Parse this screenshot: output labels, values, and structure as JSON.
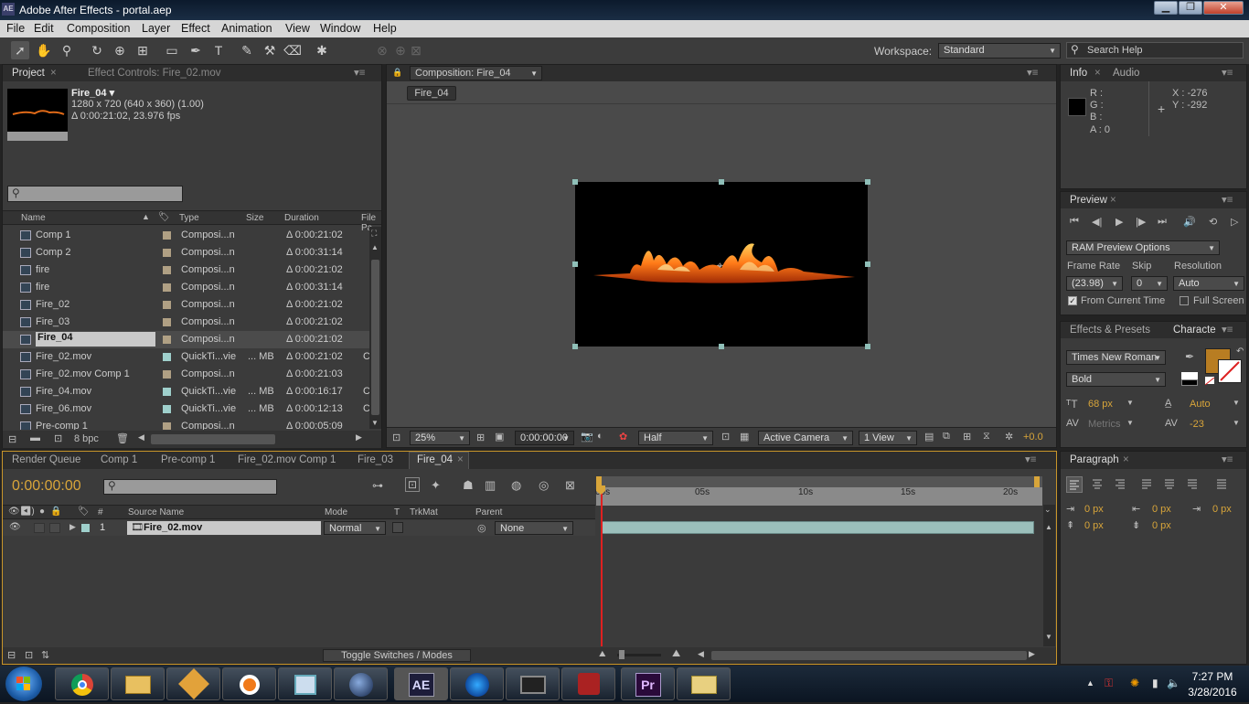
{
  "window": {
    "title": "Adobe After Effects - portal.aep",
    "app_icon": "AE",
    "controls": [
      "▁",
      "❐",
      "✕"
    ]
  },
  "menu": [
    "File",
    "Edit",
    "Composition",
    "Layer",
    "Effect",
    "Animation",
    "View",
    "Window",
    "Help"
  ],
  "toolbar": {
    "workspace_label": "Workspace:",
    "workspace_value": "Standard",
    "search_placeholder": "Search Help"
  },
  "project": {
    "tabs": [
      "Project",
      "Effect Controls: Fire_02.mov"
    ],
    "item_name": "Fire_04 ▾",
    "item_size": "1280 x 720  (640 x 360) (1.00)",
    "item_duration": "Δ 0:00:21:02, 23.976 fps",
    "columns": [
      "Name",
      "Type",
      "Size",
      "Duration",
      "File Pa"
    ],
    "rows": [
      {
        "name": "Comp 1",
        "type": "Composi...n",
        "size": "",
        "duration": "Δ 0:00:21:02",
        "label": "#b0a084",
        "kind": "comp"
      },
      {
        "name": "Comp 2",
        "type": "Composi...n",
        "size": "",
        "duration": "Δ 0:00:31:14",
        "label": "#b0a084",
        "kind": "comp"
      },
      {
        "name": "fire",
        "type": "Composi...n",
        "size": "",
        "duration": "Δ 0:00:21:02",
        "label": "#b0a084",
        "kind": "comp"
      },
      {
        "name": "fire",
        "type": "Composi...n",
        "size": "",
        "duration": "Δ 0:00:31:14",
        "label": "#b0a084",
        "kind": "comp"
      },
      {
        "name": "Fire_02",
        "type": "Composi...n",
        "size": "",
        "duration": "Δ 0:00:21:02",
        "label": "#b0a084",
        "kind": "comp"
      },
      {
        "name": "Fire_03",
        "type": "Composi...n",
        "size": "",
        "duration": "Δ 0:00:21:02",
        "label": "#b0a084",
        "kind": "comp"
      },
      {
        "name": "Fire_04",
        "type": "Composi...n",
        "size": "",
        "duration": "Δ 0:00:21:02",
        "label": "#b0a084",
        "kind": "comp",
        "selected": true
      },
      {
        "name": "Fire_02.mov",
        "type": "QuickTi...vie",
        "size": "... MB",
        "duration": "Δ 0:00:21:02",
        "label": "#9fd0cc",
        "kind": "footage",
        "extra": "C"
      },
      {
        "name": "Fire_02.mov Comp 1",
        "type": "Composi...n",
        "size": "",
        "duration": "Δ 0:00:21:03",
        "label": "#b0a084",
        "kind": "comp"
      },
      {
        "name": "Fire_04.mov",
        "type": "QuickTi...vie",
        "size": "... MB",
        "duration": "Δ 0:00:16:17",
        "label": "#9fd0cc",
        "kind": "footage",
        "extra": "C"
      },
      {
        "name": "Fire_06.mov",
        "type": "QuickTi...vie",
        "size": "... MB",
        "duration": "Δ 0:00:12:13",
        "label": "#9fd0cc",
        "kind": "footage",
        "extra": "C"
      },
      {
        "name": "Pre-comp 1",
        "type": "Composi...n",
        "size": "",
        "duration": "Δ 0:00:05:09",
        "label": "#b0a084",
        "kind": "comp"
      }
    ],
    "bpc": "8 bpc"
  },
  "composition": {
    "tab": "Composition: Fire_04",
    "breadcrumb": "Fire_04",
    "zoom": "25%",
    "timecode": "0:00:00:00",
    "resolution": "Half",
    "camera": "Active Camera",
    "views": "1 View",
    "exposure": "+0.0"
  },
  "info": {
    "tabs": [
      "Info",
      "Audio"
    ],
    "r": "R :",
    "g": "G :",
    "b": "B :",
    "a": "A : 0",
    "x": "X : -276",
    "y": "Y : -292"
  },
  "preview": {
    "tab": "Preview",
    "ram_options": "RAM Preview Options",
    "frame_rate_label": "Frame Rate",
    "skip_label": "Skip",
    "resolution_label": "Resolution",
    "frame_rate": "(23.98)",
    "skip": "0",
    "resolution": "Auto",
    "from_current": "From Current Time",
    "full_screen": "Full Screen"
  },
  "character": {
    "tabs": [
      "Effects & Presets",
      "Characte"
    ],
    "font": "Times New Roman",
    "style": "Bold",
    "size": "68 px",
    "leading": "Auto",
    "kerning": "Metrics",
    "tracking": "-23",
    "fill_color": "#b87d22"
  },
  "paragraph": {
    "tab": "Paragraph",
    "values": [
      "0 px",
      "0 px",
      "0 px",
      "0 px",
      "0 px"
    ]
  },
  "timeline": {
    "tabs": [
      "Render Queue",
      "Comp 1",
      "Pre-comp 1",
      "Fire_02.mov Comp 1",
      "Fire_03",
      "Fire_04"
    ],
    "timecode": "0:00:00:00",
    "columns": {
      "source": "Source Name",
      "mode": "Mode",
      "t": "T",
      "trkmat": "TrkMat",
      "parent": "Parent",
      "hash": "#"
    },
    "ruler": [
      "00s",
      "05s",
      "10s",
      "15s",
      "20s"
    ],
    "layer": {
      "num": "1",
      "name": "Fire_02.mov",
      "mode": "Normal",
      "parent": "None"
    },
    "toggle": "Toggle Switches / Modes"
  },
  "taskbar": {
    "time": "7:27 PM",
    "date": "3/28/2016",
    "apps": [
      "chrome-icon",
      "explorer-icon",
      "after-effects-alt-icon",
      "blender-icon",
      "photo-icon",
      "cinema4d-icon",
      "after-effects-icon",
      "globe-icon",
      "screen-icon",
      "game-icon",
      "premiere-icon",
      "folder-icon"
    ],
    "ae_label": "AE",
    "pr_label": "Pr"
  }
}
